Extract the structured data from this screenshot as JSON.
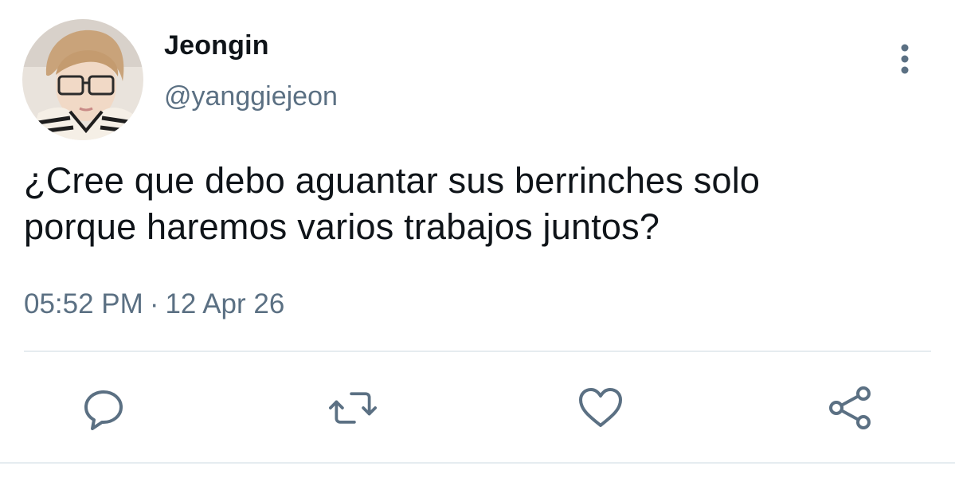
{
  "author": {
    "display_name": "Jeongin",
    "handle": "@yanggiejeon",
    "avatar_icon": "user-photo-avatar"
  },
  "tweet": {
    "text_lines": [
      "¿Cree que debo aguantar sus berrinches solo",
      "porque haremos varios trabajos juntos?"
    ],
    "time": "05:52 PM",
    "separator": "·",
    "date": "12 Apr 26"
  },
  "actions": [
    {
      "icon": "reply-icon"
    },
    {
      "icon": "retweet-icon"
    },
    {
      "icon": "like-icon"
    },
    {
      "icon": "share-icon"
    }
  ],
  "menu": {
    "icon": "more-vertical-icon"
  },
  "colors": {
    "text": "#0f1419",
    "secondary": "#5b7083",
    "divider": "#e6ecf0",
    "background": "#ffffff"
  }
}
